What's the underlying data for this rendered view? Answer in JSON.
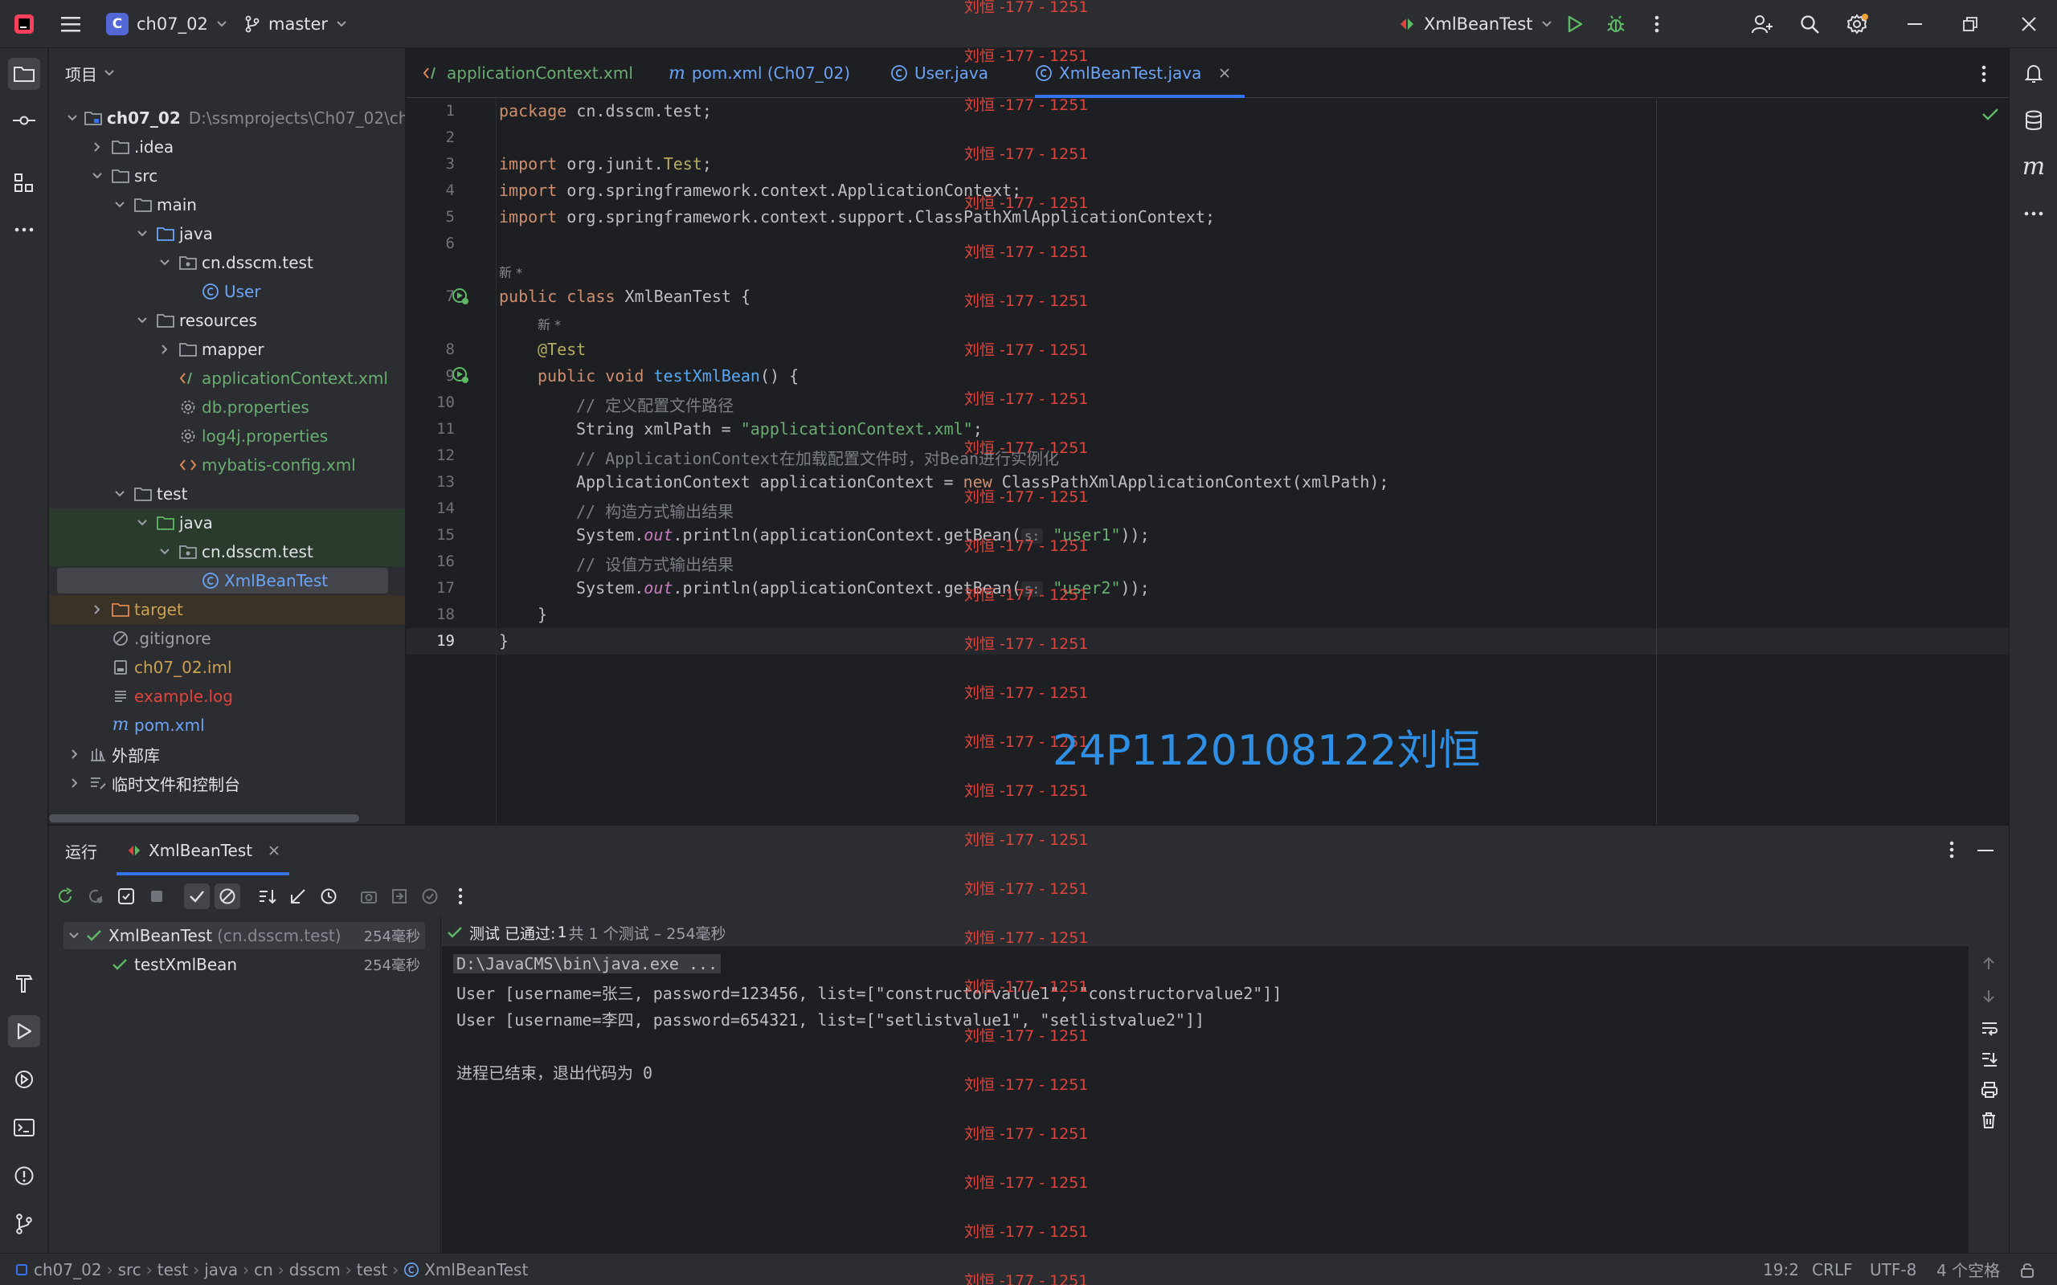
{
  "titlebar": {
    "project_badge": "C",
    "project_name": "ch07_02",
    "branch": "master",
    "run_config": "XmlBeanTest"
  },
  "project_pane": {
    "title": "项目",
    "root": {
      "name": "ch07_02",
      "path": "D:\\ssmprojects\\Ch07_02\\ch0"
    },
    "items": [
      {
        "label": ".idea"
      },
      {
        "label": "src"
      },
      {
        "label": "main"
      },
      {
        "label": "java"
      },
      {
        "label": "cn.dsscm.test"
      },
      {
        "label": "User"
      },
      {
        "label": "resources"
      },
      {
        "label": "mapper"
      },
      {
        "label": "applicationContext.xml"
      },
      {
        "label": "db.properties"
      },
      {
        "label": "log4j.properties"
      },
      {
        "label": "mybatis-config.xml"
      },
      {
        "label": "test"
      },
      {
        "label": "java"
      },
      {
        "label": "cn.dsscm.test"
      },
      {
        "label": "XmlBeanTest"
      },
      {
        "label": "target"
      },
      {
        "label": ".gitignore"
      },
      {
        "label": "ch07_02.iml"
      },
      {
        "label": "example.log"
      },
      {
        "label": "pom.xml"
      },
      {
        "label": "外部库"
      },
      {
        "label": "临时文件和控制台"
      }
    ]
  },
  "editor_tabs": [
    {
      "label": "applicationContext.xml"
    },
    {
      "label": "pom.xml (Ch07_02)"
    },
    {
      "label": "User.java"
    },
    {
      "label": "XmlBeanTest.java"
    }
  ],
  "code": {
    "line_numbers": [
      "1",
      "2",
      "3",
      "4",
      "5",
      "6",
      "7",
      "8",
      "9",
      "10",
      "11",
      "12",
      "13",
      "14",
      "15",
      "16",
      "17",
      "18",
      "19"
    ],
    "l1_kw": "package",
    "l1_rest": " cn.dsscm.test;",
    "l3_kw": "import",
    "l3_rest": " org.junit.",
    "l3_cls": "Test",
    "l3_end": ";",
    "l4_kw": "import",
    "l4_rest": " org.springframework.context.ApplicationContext;",
    "l5_kw": "import",
    "l5_rest": " org.springframework.context.support.ClassPathXmlApplicationContext;",
    "new_hint": "新 *",
    "l7_kw": "public class",
    "l7_rest": " XmlBeanTest {",
    "l8_ann": "@Test",
    "l9_kw": "public void",
    "l9_fn": "testXmlBean",
    "l9_rest": "() {",
    "l10_cmt": "// 定义配置文件路径",
    "l11_pre": "String xmlPath = ",
    "l11_str": "\"applicationContext.xml\"",
    "l11_end": ";",
    "l12_cmt": "// ApplicationContext在加载配置文件时，对Bean进行实例化",
    "l13_pre": "ApplicationContext applicationContext = ",
    "l13_kw": "new",
    "l13_rest": " ClassPathXmlApplicationContext(xmlPath);",
    "l14_cmt": "// 构造方式输出结果",
    "l15_pre": "System.",
    "l15_out": "out",
    "l15_mid": ".println(applicationContext.getBean(",
    "l15_hint": "s:",
    "l15_str": "\"user1\"",
    "l15_end": "));",
    "l16_cmt": "// 设值方式输出结果",
    "l17_pre": "System.",
    "l17_out": "out",
    "l17_mid": ".println(applicationContext.getBean(",
    "l17_hint": "s:",
    "l17_str": "\"user2\"",
    "l17_end": "));",
    "l18": "}",
    "l19": "}"
  },
  "run_panel": {
    "title": "运行",
    "tab": "XmlBeanTest",
    "test_tree": [
      {
        "name": "XmlBeanTest",
        "hint": "(cn.dsscm.test)",
        "time": "254毫秒"
      },
      {
        "name": "testXmlBean",
        "hint": "",
        "time": "254毫秒"
      }
    ],
    "summary_prefix": "测试 已通过:",
    "summary_count": "1",
    "summary_rest": "共 1 个测试 – 254毫秒",
    "console": [
      "D:\\JavaCMS\\bin\\java.exe ...",
      "User [username=张三, password=123456, list=[\"constructorvalue1\", \"constructorvalue2\"]]",
      "User [username=李四, password=654321, list=[\"setlistvalue1\", \"setlistvalue2\"]]",
      "",
      "进程已结束，退出代码为 0"
    ]
  },
  "statusbar": {
    "breadcrumbs": [
      "ch07_02",
      "src",
      "test",
      "java",
      "cn",
      "dsscm",
      "test",
      "XmlBeanTest"
    ],
    "position": "19:2",
    "line_sep": "CRLF",
    "encoding": "UTF-8",
    "indent": "4 个空格"
  },
  "watermark": {
    "repeat_text": "刘恒 -177 - 1251",
    "big_text": "24P1120108122刘恒"
  },
  "colors": {
    "accent": "#3574f0",
    "success": "#5fb865",
    "watermark_red": "#e0443e",
    "watermark_blue": "#2f8fe4"
  }
}
